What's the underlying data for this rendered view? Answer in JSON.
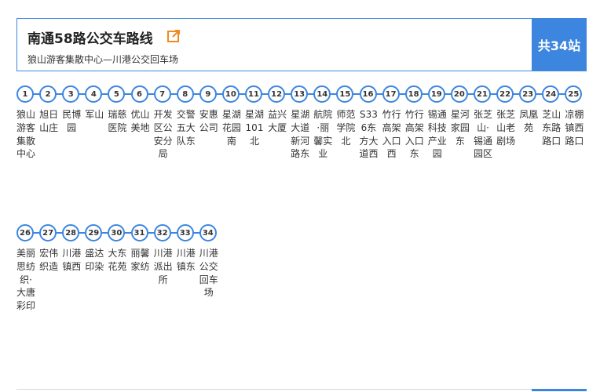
{
  "header": {
    "title": "南通58路公交车路线",
    "subtitle": "狼山游客集散中心—川港公交回车场",
    "count": "共34站"
  },
  "icons": {
    "external_link": "external-link-icon"
  },
  "colors": {
    "accent": "#3d86e0",
    "text": "#333333"
  },
  "stops": [
    {
      "num": "1",
      "name": "狼山游客集散中心"
    },
    {
      "num": "2",
      "name": "旭日山庄"
    },
    {
      "num": "3",
      "name": "民博园"
    },
    {
      "num": "4",
      "name": "军山"
    },
    {
      "num": "5",
      "name": "瑞慈医院"
    },
    {
      "num": "6",
      "name": "优山美地"
    },
    {
      "num": "7",
      "name": "开发区公安分局"
    },
    {
      "num": "8",
      "name": "交警五大队东"
    },
    {
      "num": "9",
      "name": "安惠公司"
    },
    {
      "num": "10",
      "name": "星湖花园南"
    },
    {
      "num": "11",
      "name": "星湖101北"
    },
    {
      "num": "12",
      "name": "益兴大厦"
    },
    {
      "num": "13",
      "name": "星湖大道新河路东"
    },
    {
      "num": "14",
      "name": "航院·丽馨实业"
    },
    {
      "num": "15",
      "name": "师范学院北"
    },
    {
      "num": "16",
      "name": "S336东方大道西"
    },
    {
      "num": "17",
      "name": "竹行高架入口西"
    },
    {
      "num": "18",
      "name": "竹行高架入口东"
    },
    {
      "num": "19",
      "name": "锡通科技产业园"
    },
    {
      "num": "20",
      "name": "星河家园东"
    },
    {
      "num": "21",
      "name": "张芝山·锡通园区"
    },
    {
      "num": "22",
      "name": "张芝山老剧场"
    },
    {
      "num": "23",
      "name": "凤凰苑"
    },
    {
      "num": "24",
      "name": "芝山东路路口"
    },
    {
      "num": "25",
      "name": "凉棚镇西路口"
    },
    {
      "num": "26",
      "name": "美丽思纺织·大唐彩印"
    },
    {
      "num": "27",
      "name": "宏伟织造"
    },
    {
      "num": "28",
      "name": "川港镇西"
    },
    {
      "num": "29",
      "name": "盛达印染"
    },
    {
      "num": "30",
      "name": "大东花苑"
    },
    {
      "num": "31",
      "name": "丽馨家纺"
    },
    {
      "num": "32",
      "name": "川港派出所"
    },
    {
      "num": "33",
      "name": "川港镇东"
    },
    {
      "num": "34",
      "name": "川港公交回车场"
    }
  ]
}
